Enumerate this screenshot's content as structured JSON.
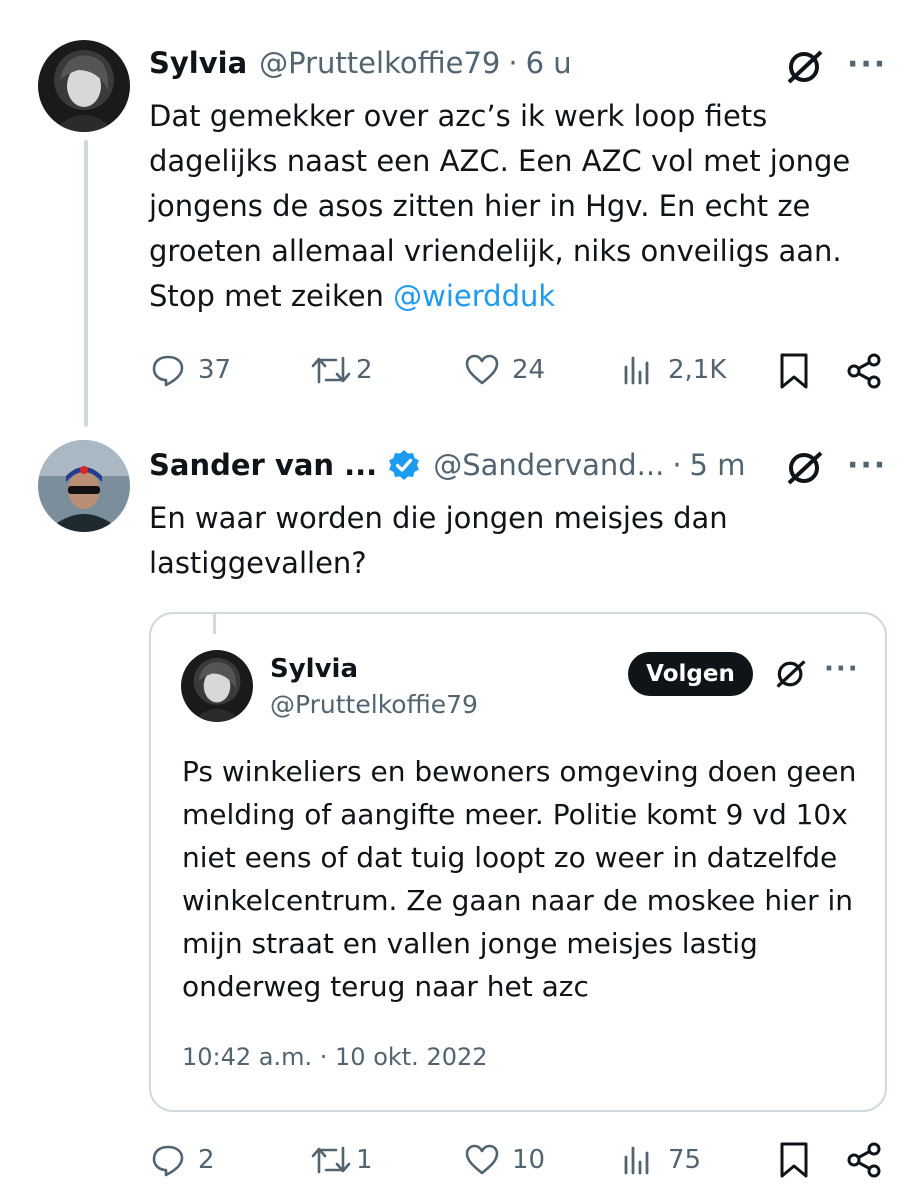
{
  "tweet1": {
    "author_name": "Sylvia",
    "handle": "@Pruttelkoffie79",
    "separator": "·",
    "time": "6 u",
    "text_lines": [
      "Dat gemekker over azc’s ik werk loop fiets",
      "dagelijks naast een AZC. Een AZC vol met jonge",
      "jongens de asos zitten hier in Hgv. En echt ze",
      "groeten allemaal vriendelijk, niks onveiligs aan.",
      "Stop met zeiken "
    ],
    "mention": "@wierdduk",
    "stats": {
      "replies": "37",
      "retweets": "2",
      "likes": "24",
      "views": "2,1K"
    }
  },
  "tweet2": {
    "author_name": "Sander van ...",
    "handle": "@Sandervand...",
    "separator": "·",
    "time": "5 m",
    "text_lines": [
      "En waar worden die jongen meisjes dan",
      "lastiggevallen?"
    ],
    "stats": {
      "replies": "2",
      "retweets": "1",
      "likes": "10",
      "views": "75"
    }
  },
  "quoted": {
    "author_name": "Sylvia",
    "handle": "@Pruttelkoffie79",
    "follow_label": "Volgen",
    "text_lines": [
      "Ps winkeliers en bewoners omgeving doen geen",
      "melding of aangifte meer. Politie komt 9 vd 10x",
      "niet eens of dat tuig loopt zo weer in datzelfde",
      "winkelcentrum. Ze gaan naar de moskee hier in",
      "mijn straat en vallen jonge meisjes lastig",
      "onderweg terug naar het azc"
    ],
    "timestamp": "10:42 a.m. · 10 okt. 2022"
  },
  "more_label": "···",
  "colors": {
    "text": "#0f1419",
    "secondary": "#536471",
    "link": "#1d9bf0",
    "verified": "#1d9bf0",
    "border": "#cfd9de"
  },
  "icons": [
    "reply-icon",
    "retweet-icon",
    "like-icon",
    "views-icon",
    "bookmark-icon",
    "share-icon",
    "grok-icon",
    "verified-badge-icon",
    "more-icon"
  ]
}
